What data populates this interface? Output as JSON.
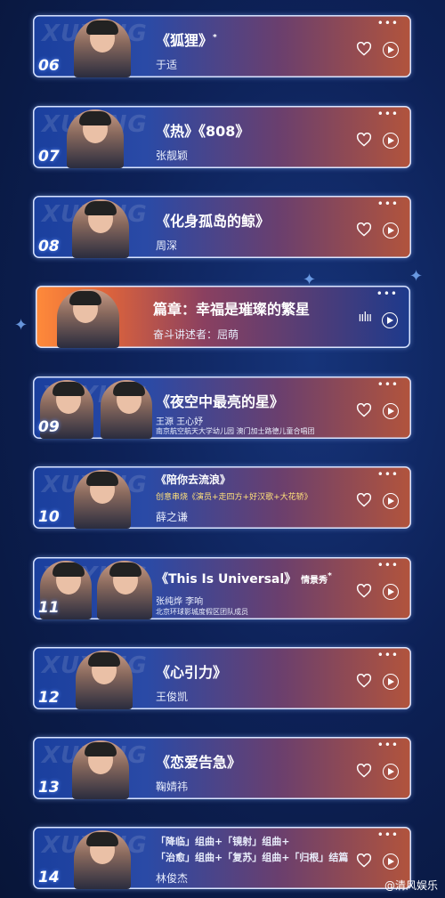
{
  "items": [
    {
      "num": "06",
      "title": "《狐狸》",
      "marker": "*",
      "artist": "于适"
    },
    {
      "num": "07",
      "title": "《热》《808》",
      "artist": "张靓颖"
    },
    {
      "num": "08",
      "title": "《化身孤岛的鲸》",
      "artist": "周深"
    },
    {
      "title": "篇章：幸福是璀璨的繁星",
      "artist": "奋斗讲述者：屈萌"
    },
    {
      "num": "09",
      "title": "《夜空中最亮的星》",
      "artist": "王源    王心妤",
      "detail": "南京航空航天大学幼儿园     澳门加士路德儿童合唱团"
    },
    {
      "num": "10",
      "title": "《陪你去流浪》",
      "detail": "创意串烧《演员+走四方+好汉歌+大花轿》",
      "artist": "薛之谦"
    },
    {
      "num": "11",
      "title": "《This Is Universal》",
      "suffix": "情景秀",
      "marker": "*",
      "artist": "张纯烨    李响",
      "detail": "北京环球影城度假区团队成员"
    },
    {
      "num": "12",
      "title": "《心引力》",
      "artist": "王俊凯"
    },
    {
      "num": "13",
      "title": "《恋爱告急》",
      "artist": "鞠婧祎"
    },
    {
      "num": "14",
      "line1": "「降临」组曲+「镜射」组曲+",
      "line2": "「治愈」组曲+「复苏」组曲+「归根」结篇",
      "artist": "林俊杰"
    }
  ],
  "ghost_text": "XUYING",
  "more_icon": "more-dots-icon",
  "watermark": "@清风娱乐"
}
